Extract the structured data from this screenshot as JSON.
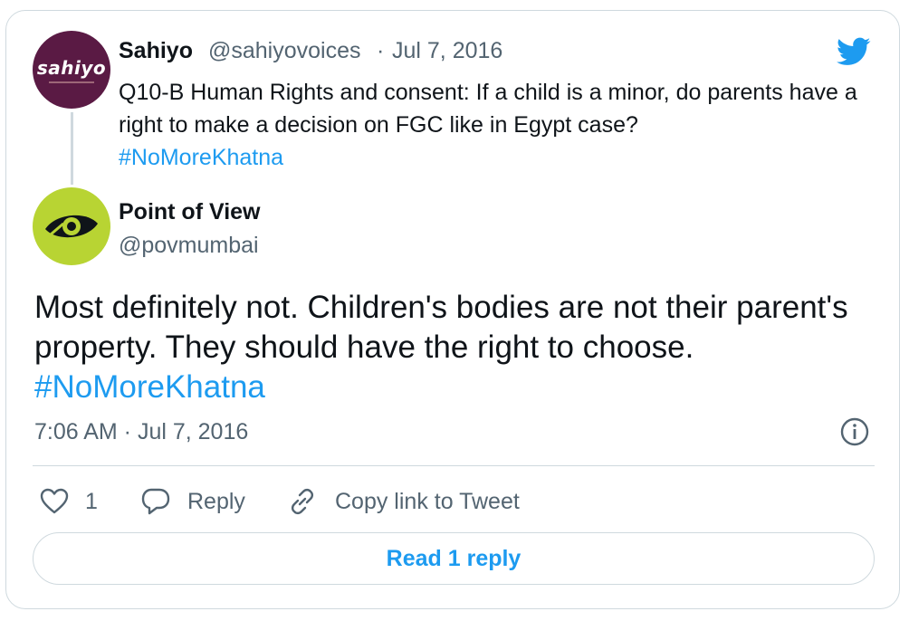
{
  "original_tweet": {
    "avatar_text": "sahiyo",
    "author_name": "Sahiyo",
    "handle": "@sahiyovoices",
    "separator": "·",
    "date": "Jul 7, 2016",
    "text": "Q10-B Human Rights and consent: If a child is a minor, do parents have a right to make a decision on FGC like in Egypt case?",
    "hashtag": "#NoMoreKhatna"
  },
  "reply_tweet": {
    "author_name": "Point of View",
    "handle": "@povmumbai",
    "text": "Most definitely not. Children's bodies are not their parent's property. They should have the right to choose.",
    "hashtag": "#NoMoreKhatna",
    "timestamp": "7:06 AM · Jul 7, 2016"
  },
  "actions": {
    "like_count": "1",
    "reply_label": "Reply",
    "copy_link_label": "Copy link to Tweet"
  },
  "read_replies_label": "Read 1 reply",
  "colors": {
    "accent": "#1d9bf0",
    "muted_text": "#536471",
    "border": "#cfd9de",
    "sahiyo_avatar_bg": "#5a1a44",
    "pov_avatar_bg": "#b8d433"
  },
  "icons": [
    "twitter-bird-icon",
    "info-icon",
    "heart-icon",
    "reply-bubble-icon",
    "link-icon",
    "eye-logo-icon"
  ]
}
